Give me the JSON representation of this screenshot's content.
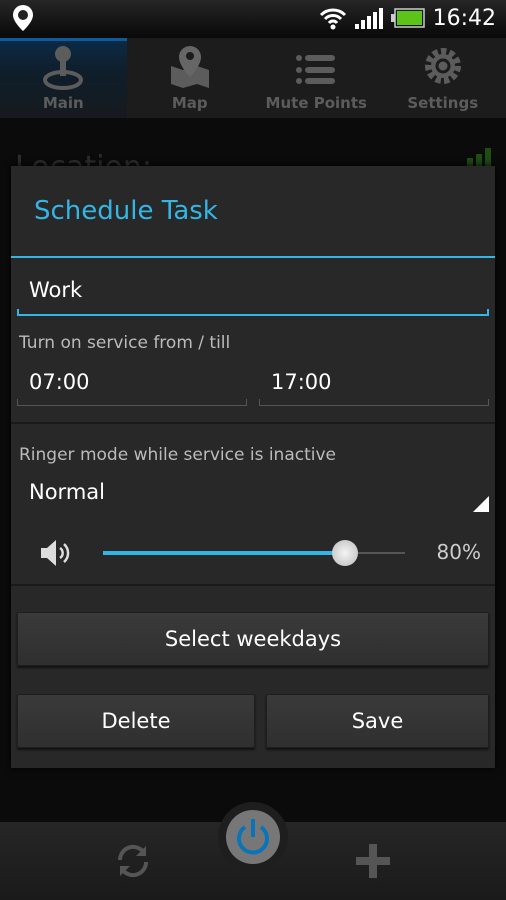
{
  "status_bar": {
    "time": "16:42",
    "icons": [
      "location-pin-icon",
      "wifi-icon",
      "signal-icon",
      "battery-icon"
    ]
  },
  "tabs": [
    {
      "label": "Main",
      "icon": "joystick-icon",
      "active": true
    },
    {
      "label": "Map",
      "icon": "map-icon"
    },
    {
      "label": "Mute Points",
      "icon": "list-icon"
    },
    {
      "label": "Settings",
      "icon": "gear-icon"
    }
  ],
  "background": {
    "location_label": "Location:"
  },
  "dialog": {
    "title": "Schedule Task",
    "name_value": "Work",
    "service_label": "Turn on service from / till",
    "from_time": "07:00",
    "till_time": "17:00",
    "ringer_label": "Ringer mode while service is inactive",
    "ringer_mode": "Normal",
    "volume_percent": 80,
    "volume_text": "80%",
    "select_weekdays": "Select weekdays",
    "delete": "Delete",
    "save": "Save"
  },
  "bottom_bar": {
    "icons": [
      "refresh-icon",
      "power-icon",
      "plus-icon"
    ]
  },
  "colors": {
    "accent": "#33b5e5",
    "power": "#0a74b8"
  }
}
